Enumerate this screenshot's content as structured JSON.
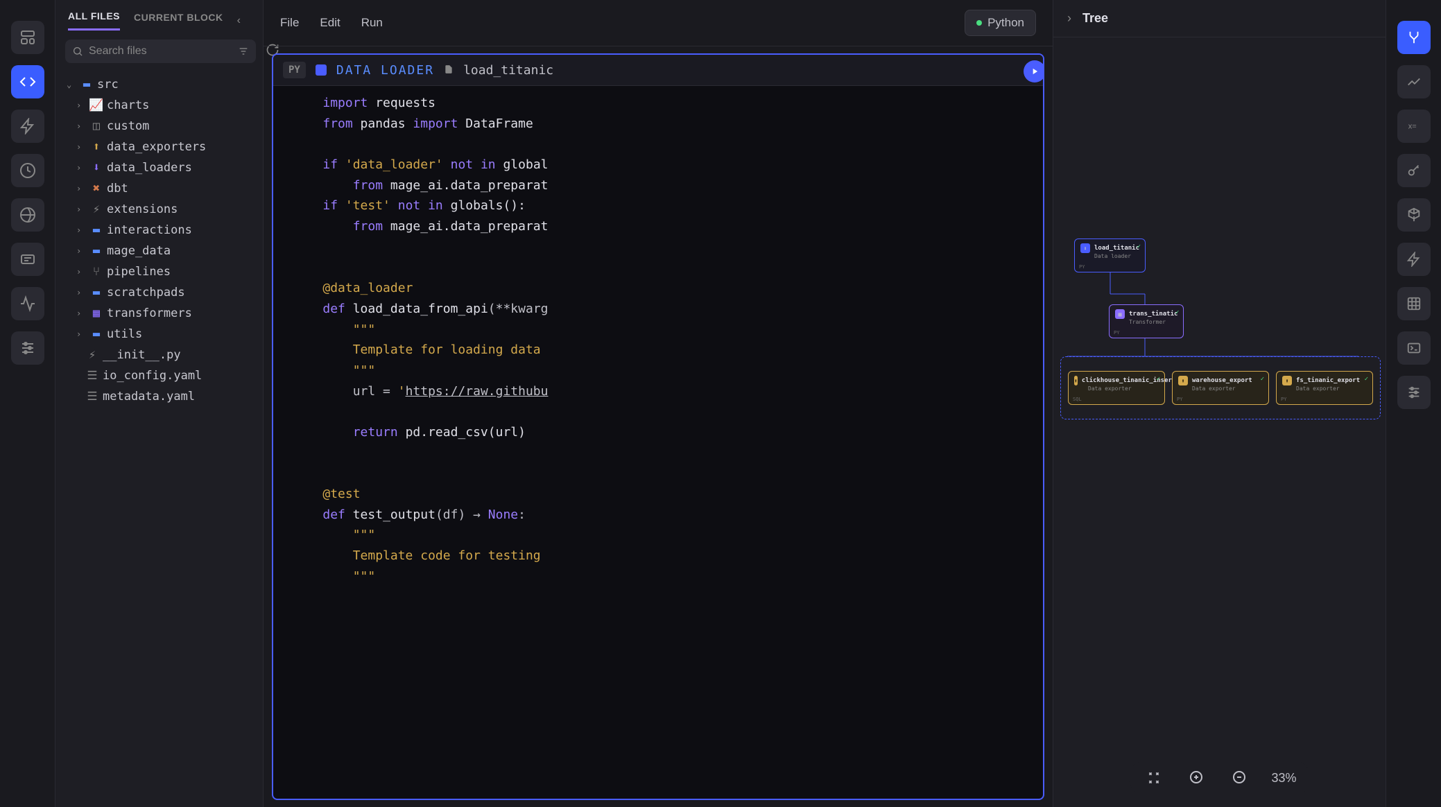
{
  "file_panel": {
    "tabs": {
      "all_files": "ALL FILES",
      "current_block": "CURRENT BLOCK"
    },
    "search_placeholder": "Search files",
    "root": "src",
    "folders": [
      {
        "name": "charts",
        "icon": "chart"
      },
      {
        "name": "custom",
        "icon": "cube"
      },
      {
        "name": "data_exporters",
        "icon": "export",
        "color": "yellow"
      },
      {
        "name": "data_loaders",
        "icon": "import",
        "color": "purple"
      },
      {
        "name": "dbt",
        "icon": "dbt",
        "color": "orange"
      },
      {
        "name": "extensions",
        "icon": "bolt"
      },
      {
        "name": "interactions",
        "icon": "folder",
        "color": "folder"
      },
      {
        "name": "mage_data",
        "icon": "folder",
        "color": "folder"
      },
      {
        "name": "pipelines",
        "icon": "pipeline"
      },
      {
        "name": "scratchpads",
        "icon": "folder",
        "color": "folder"
      },
      {
        "name": "transformers",
        "icon": "transform",
        "color": "purple"
      },
      {
        "name": "utils",
        "icon": "folder",
        "color": "folder"
      }
    ],
    "files": [
      {
        "name": "__init__.py",
        "icon": "bolt"
      },
      {
        "name": "io_config.yaml",
        "icon": "list"
      },
      {
        "name": "metadata.yaml",
        "icon": "list"
      }
    ]
  },
  "editor": {
    "menu": {
      "file": "File",
      "edit": "Edit",
      "run": "Run"
    },
    "language": "Python",
    "block": {
      "lang_badge": "PY",
      "type": "DATA LOADER",
      "name": "load_titanic"
    },
    "code": [
      {
        "indent": 1,
        "tokens": [
          {
            "t": "import ",
            "c": "kw"
          },
          {
            "t": "requests",
            "c": "fn"
          }
        ]
      },
      {
        "indent": 1,
        "tokens": [
          {
            "t": "from ",
            "c": "kw"
          },
          {
            "t": "pandas ",
            "c": "fn"
          },
          {
            "t": "import ",
            "c": "kw"
          },
          {
            "t": "DataFrame",
            "c": "fn"
          }
        ]
      },
      {
        "indent": 1,
        "tokens": []
      },
      {
        "indent": 1,
        "tokens": [
          {
            "t": "if ",
            "c": "kw"
          },
          {
            "t": "'data_loader'",
            "c": "str"
          },
          {
            "t": " not in ",
            "c": "kw"
          },
          {
            "t": "global",
            "c": "fn"
          }
        ]
      },
      {
        "indent": 2,
        "tokens": [
          {
            "t": "from ",
            "c": "kw"
          },
          {
            "t": "mage_ai.data_preparat",
            "c": "fn"
          }
        ]
      },
      {
        "indent": 1,
        "tokens": [
          {
            "t": "if ",
            "c": "kw"
          },
          {
            "t": "'test'",
            "c": "str"
          },
          {
            "t": " not in ",
            "c": "kw"
          },
          {
            "t": "globals():",
            "c": "fn"
          }
        ]
      },
      {
        "indent": 2,
        "tokens": [
          {
            "t": "from ",
            "c": "kw"
          },
          {
            "t": "mage_ai.data_preparat",
            "c": "fn"
          }
        ]
      },
      {
        "indent": 1,
        "tokens": []
      },
      {
        "indent": 1,
        "tokens": []
      },
      {
        "indent": 1,
        "tokens": [
          {
            "t": "@data_loader",
            "c": "dec"
          }
        ]
      },
      {
        "indent": 1,
        "tokens": [
          {
            "t": "def ",
            "c": "kw"
          },
          {
            "t": "load_data_from_api",
            "c": "fn"
          },
          {
            "t": "(**kwarg",
            "c": "op"
          }
        ]
      },
      {
        "indent": 2,
        "tokens": [
          {
            "t": "\"\"\"",
            "c": "str"
          }
        ]
      },
      {
        "indent": 2,
        "tokens": [
          {
            "t": "Template for loading data",
            "c": "str"
          }
        ]
      },
      {
        "indent": 2,
        "tokens": [
          {
            "t": "\"\"\"",
            "c": "str"
          }
        ]
      },
      {
        "indent": 2,
        "tokens": [
          {
            "t": "url = ",
            "c": "op"
          },
          {
            "t": "'",
            "c": "str"
          },
          {
            "t": "https://raw.githubu",
            "c": "url"
          }
        ]
      },
      {
        "indent": 2,
        "tokens": []
      },
      {
        "indent": 2,
        "tokens": [
          {
            "t": "return ",
            "c": "kw"
          },
          {
            "t": "pd.read_csv(url)",
            "c": "fn"
          }
        ]
      },
      {
        "indent": 1,
        "tokens": []
      },
      {
        "indent": 1,
        "tokens": []
      },
      {
        "indent": 1,
        "tokens": [
          {
            "t": "@test",
            "c": "dec"
          }
        ]
      },
      {
        "indent": 1,
        "tokens": [
          {
            "t": "def ",
            "c": "kw"
          },
          {
            "t": "test_output",
            "c": "fn"
          },
          {
            "t": "(df) → ",
            "c": "op"
          },
          {
            "t": "None",
            "c": "kw"
          },
          {
            "t": ":",
            "c": "op"
          }
        ]
      },
      {
        "indent": 2,
        "tokens": [
          {
            "t": "\"\"\"",
            "c": "str"
          }
        ]
      },
      {
        "indent": 2,
        "tokens": [
          {
            "t": "Template code for testing",
            "c": "str"
          }
        ]
      },
      {
        "indent": 2,
        "tokens": [
          {
            "t": "\"\"\"",
            "c": "str"
          }
        ]
      }
    ]
  },
  "tree": {
    "title": "Tree",
    "nodes": {
      "loader": {
        "title": "load_titanic",
        "sub": "Data loader",
        "badge": "PY"
      },
      "transformer": {
        "title": "trans_tinatic",
        "sub": "Transformer",
        "badge": "PY"
      },
      "exporters": [
        {
          "title": "clickhouse_tinanic_insert",
          "sub": "Data exporter",
          "badge": "SQL"
        },
        {
          "title": "warehouse_export",
          "sub": "Data exporter",
          "badge": "PY"
        },
        {
          "title": "fs_tinanic_export",
          "sub": "Data exporter",
          "badge": "PY"
        }
      ]
    },
    "zoom": "33%"
  }
}
